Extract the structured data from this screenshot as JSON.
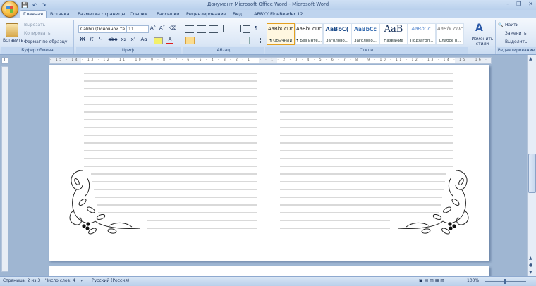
{
  "window": {
    "title": "Документ Microsoft Office Word - Microsoft Word",
    "controls": [
      "–",
      "❐",
      "✕"
    ]
  },
  "quick_access": [
    "💾",
    "↶",
    "↷"
  ],
  "tabs": [
    "Главная",
    "Вставка",
    "Разметка страницы",
    "Ссылки",
    "Рассылки",
    "Рецензирование",
    "Вид",
    "ABBYY FineReader 12"
  ],
  "clipboard": {
    "paste": "Вставить",
    "cut": "Вырезать",
    "copy": "Копировать",
    "format_painter": "Формат по образцу",
    "label": "Буфер обмена"
  },
  "font": {
    "name": "Calibri (Основной те",
    "size": "11",
    "label": "Шрифт",
    "bold": "Ж",
    "italic": "К",
    "underline": "Ч",
    "strike": "abc",
    "sub": "x₂",
    "sup": "x²",
    "case": "Aa",
    "grow": "A˄",
    "shrink": "A˅",
    "clear": "⌫"
  },
  "paragraph": {
    "label": "Абзац",
    "pilcrow": "¶"
  },
  "styles": {
    "label": "Стили",
    "items": [
      {
        "preview": "AaBbCcDc",
        "name": "¶ Обычный"
      },
      {
        "preview": "AaBbCcDc",
        "name": "¶ Без инте..."
      },
      {
        "preview": "AaBbC(",
        "name": "Заголово..."
      },
      {
        "preview": "AaBbCc",
        "name": "Заголово..."
      },
      {
        "preview": "AaB",
        "name": "Название"
      },
      {
        "preview": "AaBbCc.",
        "name": "Подзагол..."
      },
      {
        "preview": "AaBbCcDc",
        "name": "Слабое в..."
      }
    ],
    "change": "Изменить стили"
  },
  "editing": {
    "label": "Редактирование",
    "find": "Найти",
    "replace": "Заменить",
    "select": "Выделить"
  },
  "ruler_ticks": "· 15 · 14 · 13 · 12 · 11 · 10 · 9 · 8 · 7 · 6 · 5 · 4 · 3 · 2 · 1 · · · 1 · 2 · 3 · 4 · 5 · 6 · 7 · 8 · 9 · 10 · 11 · 12 · 13 · 14 · 15 · 16 · 17 · 18 · 19 · 20 · 21 · 22 · 23",
  "statusbar": {
    "page": "Страница: 2 из 3",
    "words": "Число слов: 4",
    "language": "Русский (Россия)",
    "zoom": "100%"
  },
  "colors": {
    "accent": "#e3a021",
    "ribbon": "#dbe7f6",
    "frame": "#9fb6d2"
  }
}
